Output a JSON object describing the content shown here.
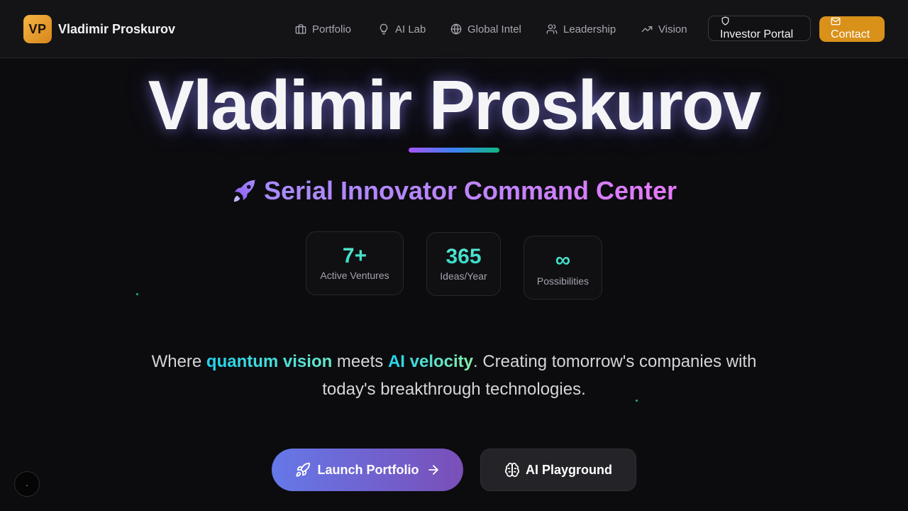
{
  "brand": {
    "logo_text": "VP",
    "name": "Vladimir Proskurov"
  },
  "nav": {
    "items": [
      {
        "label": "Portfolio",
        "icon": "briefcase-icon"
      },
      {
        "label": "AI Lab",
        "icon": "lightbulb-icon"
      },
      {
        "label": "Global Intel",
        "icon": "globe-icon"
      },
      {
        "label": "Leadership",
        "icon": "users-icon"
      },
      {
        "label": "Vision",
        "icon": "trending-up-icon"
      }
    ],
    "investor_portal": {
      "label": "Investor Portal",
      "icon": "shield-icon"
    },
    "contact": {
      "label": "Contact",
      "icon": "mail-icon"
    }
  },
  "hero": {
    "title": "Vladimir Proskurov",
    "subtitle": "Serial Innovator Command Center",
    "subtitle_icon": "rocket-icon",
    "stats": [
      {
        "value": "7+",
        "label": "Active Ventures"
      },
      {
        "value": "365",
        "label": "Ideas/Year"
      },
      {
        "value": "∞",
        "label": "Possibilities"
      }
    ],
    "tagline": {
      "part1": "Where ",
      "highlight1": "quantum vision",
      "part2": " meets ",
      "highlight2": "AI velocity",
      "part3": ". Creating tomorrow's companies with today's breakthrough technologies."
    },
    "cta_primary": {
      "label": "Launch Portfolio",
      "icon": "rocket-icon",
      "trailing_icon": "arrow-right-icon"
    },
    "cta_secondary": {
      "label": "AI Playground",
      "icon": "brain-icon"
    }
  },
  "colors": {
    "background": "#0c0c0f",
    "brand_gold": "#d9911a",
    "accent_teal": "#2dd4bf",
    "accent_purple": "#a78bfa"
  }
}
